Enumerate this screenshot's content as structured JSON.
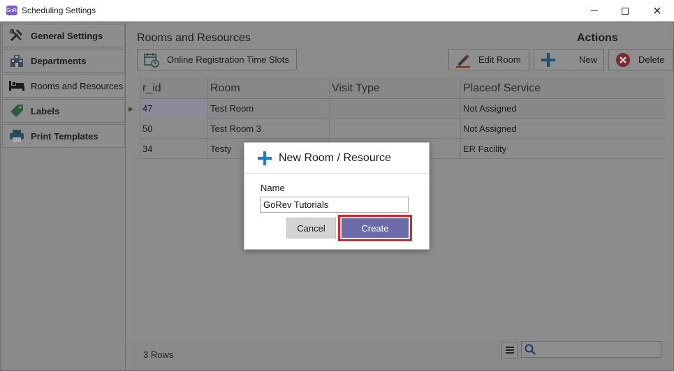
{
  "window": {
    "title": "Scheduling Settings",
    "app_icon_text": "GoRev"
  },
  "sidebar": {
    "items": [
      {
        "label": "General Settings",
        "icon": "tools-icon"
      },
      {
        "label": "Departments",
        "icon": "building-icon"
      },
      {
        "label": "Rooms and Resources",
        "icon": "bed-icon",
        "active": true
      },
      {
        "label": "Labels",
        "icon": "tag-icon"
      },
      {
        "label": "Print Templates",
        "icon": "printer-icon"
      }
    ]
  },
  "main": {
    "section_title": "Rooms and Resources",
    "actions_title": "Actions",
    "online_slots_label": "Online Registration Time Slots",
    "edit_room_label": "Edit Room",
    "new_label": "New",
    "delete_label": "Delete"
  },
  "grid": {
    "columns": [
      "r_id",
      "Room",
      "Visit Type",
      "Placeof Service"
    ],
    "rows": [
      {
        "r_id": "47",
        "room": "Test Room",
        "visit_type": "",
        "place_of_service": "Not Assigned"
      },
      {
        "r_id": "50",
        "room": "Test Room 3",
        "visit_type": "",
        "place_of_service": "Not Assigned"
      },
      {
        "r_id": "34",
        "room": "Testy",
        "visit_type": "",
        "place_of_service": "ER Facility"
      }
    ]
  },
  "footer": {
    "rows_count": "3 Rows",
    "search_value": ""
  },
  "dialog": {
    "title": "New Room /  Resource",
    "name_label": "Name",
    "name_value": "GoRev Tutorials",
    "cancel_label": "Cancel",
    "create_label": "Create"
  },
  "colors": {
    "accent_blue": "#1f7fc4",
    "create_button": "#6a6ba8",
    "highlight_border": "#e0212f",
    "delete_red": "#d9363e"
  }
}
